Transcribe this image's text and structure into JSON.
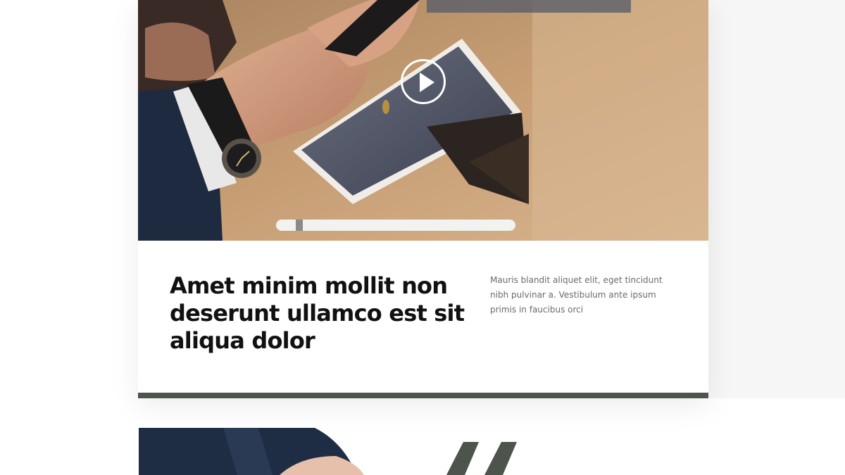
{
  "feature": {
    "video_button_label": "play",
    "headline": "Amet minim mollit non deserunt ullamco est sit aliqua dolor",
    "description": "Mauris blandit aliquet elit, eget tincidunt nibh pulvinar a. Vestibulum ante ipsum primis in faucibus orci",
    "accent_color": "#4c544b"
  },
  "icons": {
    "play": "play-circle-icon",
    "quote": "quote-mark-icon"
  },
  "colors": {
    "text_dark": "#111111",
    "text_muted": "#6a6a6a",
    "side_band": "#f6f6f6"
  }
}
